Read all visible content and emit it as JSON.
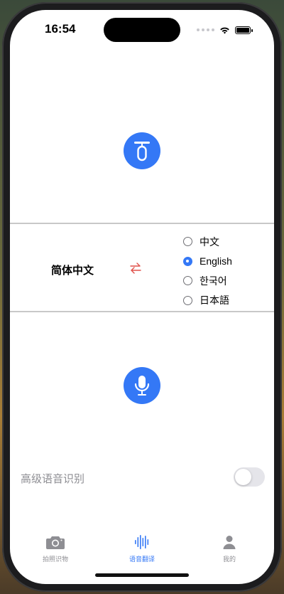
{
  "status_bar": {
    "time": "16:54"
  },
  "translate": {
    "source_language": "简体中文",
    "target_options": [
      {
        "label": "中文",
        "selected": false
      },
      {
        "label": "English",
        "selected": true
      },
      {
        "label": "한국어",
        "selected": false
      },
      {
        "label": "日本語",
        "selected": false
      }
    ],
    "top_button_icon": "speech-stand-icon",
    "mic_button_icon": "microphone-icon",
    "swap_icon": "swap-arrows-icon"
  },
  "settings": {
    "advanced_recognition_label": "高级语音识别",
    "advanced_recognition_enabled": false
  },
  "tabs": [
    {
      "label": "拍照识物",
      "icon": "camera-icon",
      "active": false
    },
    {
      "label": "语音翻译",
      "icon": "waveform-icon",
      "active": true
    },
    {
      "label": "我的",
      "icon": "person-icon",
      "active": false
    }
  ],
  "colors": {
    "accent": "#3478f6",
    "swap": "#e0504a",
    "inactive": "#8e8e93",
    "divider": "#c8c8c8"
  }
}
